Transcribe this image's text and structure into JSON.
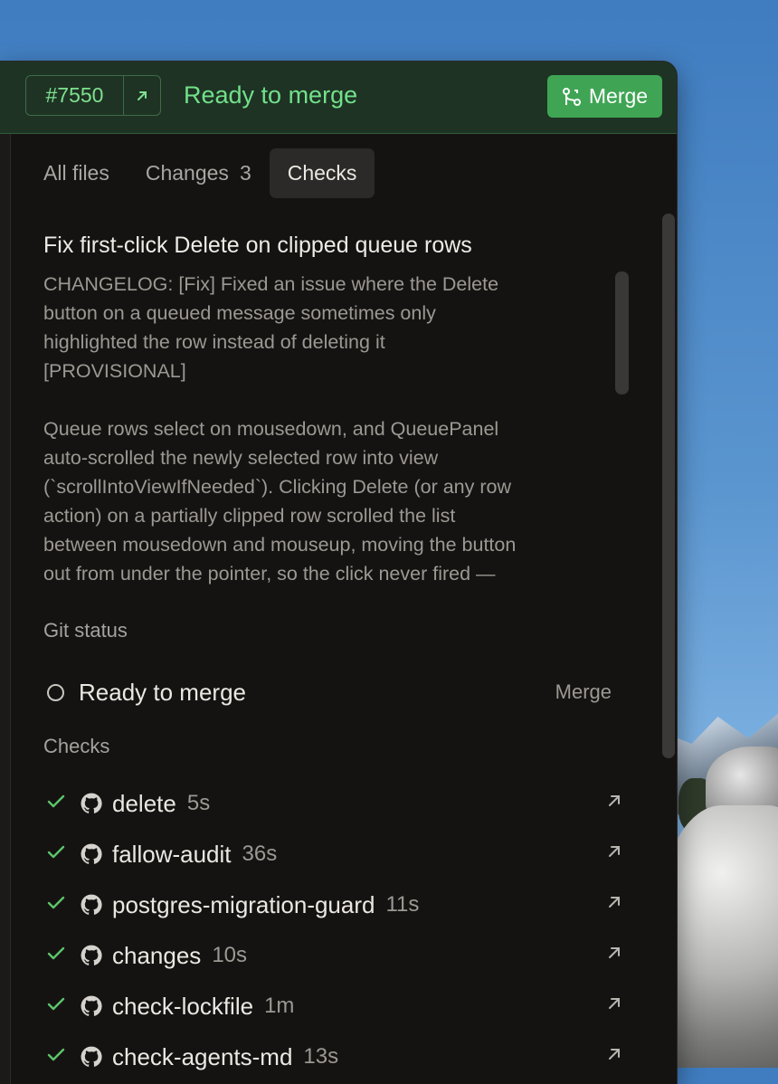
{
  "header": {
    "pr_number": "#7550",
    "open_icon": "arrow-up-right-icon",
    "status": "Ready to merge",
    "merge_label": "Merge",
    "colors": {
      "header_bg": "#1e3324",
      "accent": "#72e08a",
      "merge_bg": "#3fa554"
    }
  },
  "tabs": [
    {
      "label": "All files",
      "count": ""
    },
    {
      "label": "Changes",
      "count": "3"
    },
    {
      "label": "Checks",
      "count": "",
      "active": true
    }
  ],
  "description": {
    "title": "Fix first-click Delete on clipped queue rows",
    "body": "CHANGELOG: [Fix] Fixed an issue where the Delete\nbutton on a queued message sometimes only\nhighlighted the row instead of deleting it\n[PROVISIONAL]\n\nQueue rows select on mousedown, and QueuePanel\nauto-scrolled the newly selected row into view\n(`scrollIntoViewIfNeeded`). Clicking Delete (or any row\naction) on a partially clipped row scrolled the list\nbetween mousedown and mouseup, moving the button\nout from under the pointer, so the click never fired —"
  },
  "git_status": {
    "label": "Git status",
    "state": "Ready to merge",
    "action": "Merge"
  },
  "checks": {
    "label": "Checks",
    "items": [
      {
        "name": "delete",
        "duration": "5s"
      },
      {
        "name": "fallow-audit",
        "duration": "36s"
      },
      {
        "name": "postgres-migration-guard",
        "duration": "11s"
      },
      {
        "name": "changes",
        "duration": "10s"
      },
      {
        "name": "check-lockfile",
        "duration": "1m"
      },
      {
        "name": "check-agents-md",
        "duration": "13s"
      }
    ],
    "status_color": "#5cc56b"
  }
}
